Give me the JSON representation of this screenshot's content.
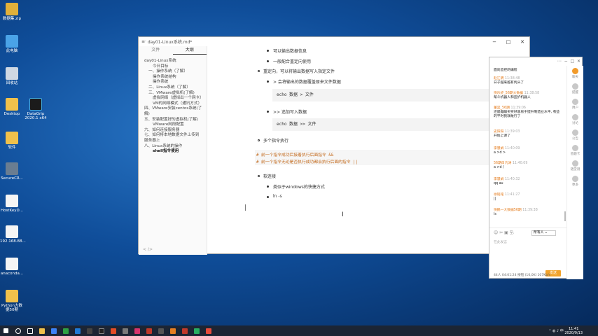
{
  "desktop": {
    "icons": [
      "数据集.zip",
      "此电脑",
      "回收站",
      "Desktop",
      "DataGrip 2020.1 x64",
      "软件",
      "SecureCR...",
      "HostKeyD...",
      "192.168.88...",
      "anaconda...",
      "Python大数据50期"
    ]
  },
  "typora": {
    "title": "day01-Linux系统.md*",
    "tabs": [
      "文件",
      "大纲"
    ],
    "outline": [
      "day01-Linux系统",
      "今日目标",
      "一、操作系统（了解）",
      "操作系统结构",
      "操作系统",
      "二、Linux系统（了解）",
      "三、VMware虚拟机(了解)",
      "虚拟网络（虚拟出一个网卡）",
      "VM的网络模式（通讯方式）",
      "四、VMware安装centos系统(了解)",
      "五、安装配置好的虚拟机(了解)",
      "VMware网段配置",
      "六、如何连接服务器",
      "七、如何将本地数据文件上传到服务器上",
      "八、Linux系统的操作",
      "shell指令使用"
    ],
    "content": {
      "l1": "可以输出数据信息",
      "l2": "一般配合重定向使用",
      "l3": "重定向，可以将输出数据写入指定文件",
      "l4": ">  会将输出的数据覆盖原来文件数据",
      "c1": "echo  数据  > 文件",
      "l5": ">>  追加写入数据",
      "c2": "echo  数据  >>  文件",
      "l6": "多个指令执行",
      "k1": "# 前一个指令成功后接着执行后面指令  &&",
      "k2": "# 前一个指令无论是否执行成功都会执行后面的指令   ||",
      "l7": "软连接",
      "l8": "类似于windows的快捷方式",
      "l9": "ln -s"
    },
    "footer": "< />"
  },
  "chat": {
    "header": "面向监控的编程",
    "messages": [
      {
        "name": "赵江明",
        "time": "11:38:48",
        "text": "日子越来越有判头了"
      },
      {
        "name": "快乐虾_56期大数据",
        "time": "11:38:58",
        "text": "帮斗机器人和监护机器人"
      },
      {
        "name": "董昊_56期",
        "time": "11:39:06",
        "text": "还是蹦蹦买买好容易于提升制造业水平, 有些的平时我就敢行了"
      },
      {
        "name": "史阳阳",
        "time": "11:39:03",
        "text": "开始上课了"
      },
      {
        "name": "李慧娟",
        "time": "11:40:09",
        "text": "a  >d  >"
      },
      {
        "name": "56期白凡涛",
        "time": "11:40:09",
        "text": "a  >d  /"
      },
      {
        "name": "李慧娟",
        "time": "11:40:32",
        "text": "qq  au"
      },
      {
        "name": "徐铭铭",
        "time": "11:41:27",
        "text": "||"
      },
      {
        "name": "快鹏一大数据56期",
        "time": "11:39:38",
        "text": "ls"
      }
    ],
    "recipient": "所有人",
    "input_placeholder": "在此发言",
    "send": "发送",
    "status": "44人  04:01:24  按钮  (10,0KI 107Kb/s",
    "rail": [
      "聊天",
      "提醒",
      "用户",
      "讨论",
      "公告",
      "答题卡",
      "随堂测",
      "更多"
    ]
  },
  "taskbar": {
    "time": "11:41",
    "date": "2020/9/13"
  }
}
